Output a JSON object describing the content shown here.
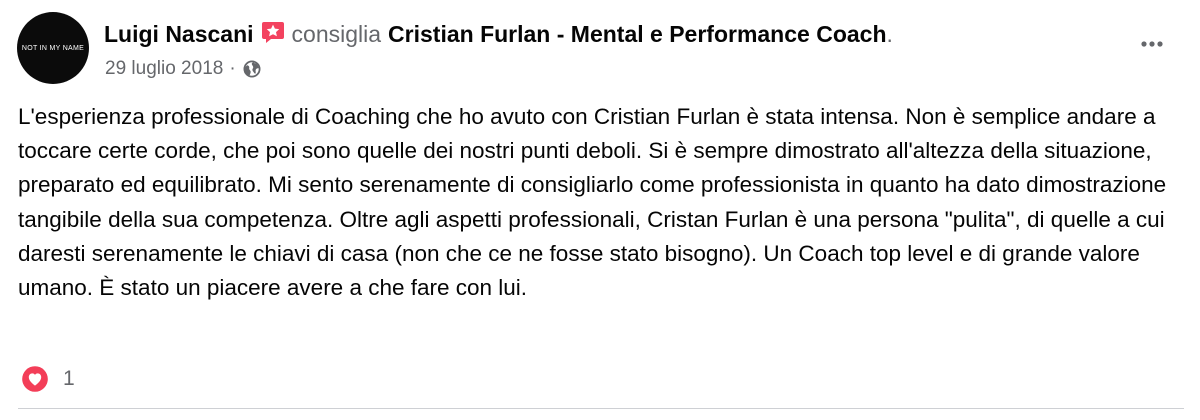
{
  "post": {
    "avatar_text": "NOT IN MY NAME",
    "author": "Luigi Nascani",
    "verb": "consiglia",
    "page_name": "Cristian Furlan - Mental e Performance Coach",
    "end_dot": ".",
    "date": "29 luglio 2018",
    "separator": "·",
    "more_icon": "more-horizontal-icon",
    "recommend_icon": "recommend-star-icon",
    "privacy_icon": "globe-icon",
    "body": "L'esperienza professionale di Coaching che ho avuto con Cristian Furlan è stata intensa. Non è semplice andare a toccare certe corde, che poi sono quelle dei nostri punti deboli. Si è sempre dimostrato all'altezza della situazione, preparato ed equilibrato. Mi sento serenamente di consigliarlo come professionista in quanto ha dato dimostrazione tangibile della sua competenza. Oltre agli aspetti professionali, Cristan Furlan è una persona \"pulita\", di quelle a cui daresti serenamente le chiavi di casa (non che ce ne fosse stato bisogno). Un Coach top level e di grande valore umano. È stato un piacere avere a che fare con lui.",
    "reactions": {
      "icon": "love-reaction-icon",
      "count": "1"
    }
  },
  "colors": {
    "text_primary": "#050505",
    "text_secondary": "#65676b",
    "recommend_red": "#f3425f",
    "love_red": "#f33e58",
    "divider": "#ced0d4"
  }
}
